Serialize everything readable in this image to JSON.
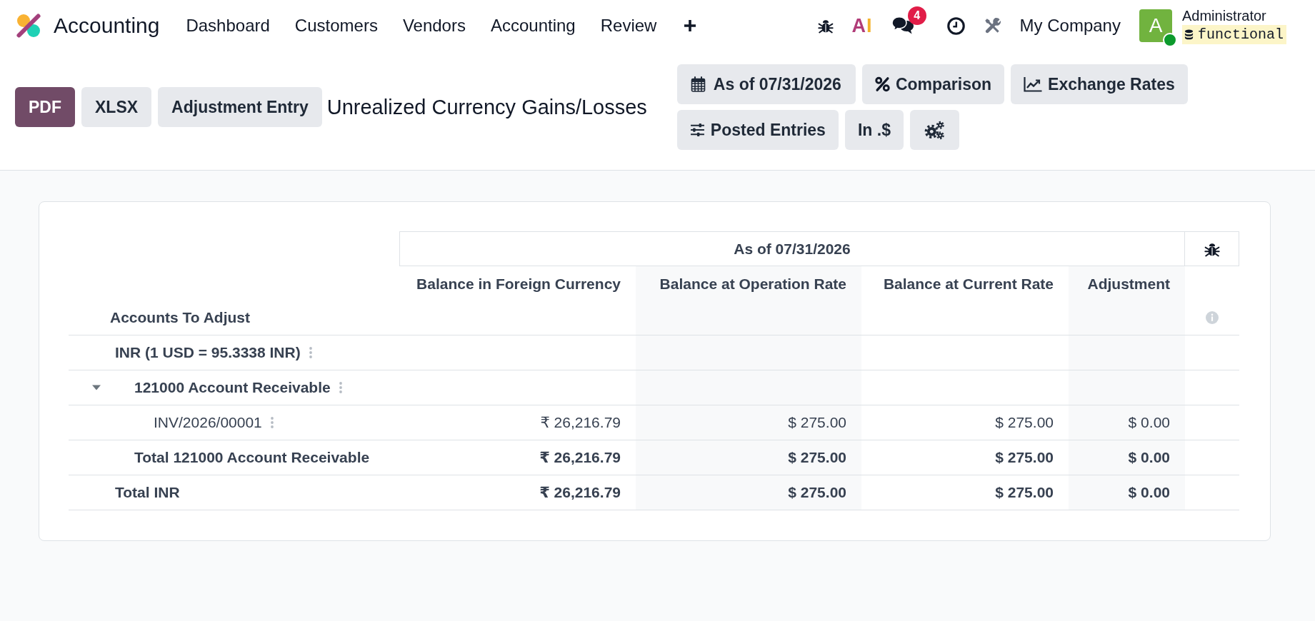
{
  "navbar": {
    "app_name": "Accounting",
    "menu": [
      "Dashboard",
      "Customers",
      "Vendors",
      "Accounting",
      "Review"
    ]
  },
  "systray": {
    "ai_label": "AI",
    "chat_count": "4",
    "company": "My Company",
    "user": {
      "avatar_letter": "A",
      "online": true,
      "name": "Administrator",
      "database": "functional"
    }
  },
  "control_panel": {
    "buttons": [
      {
        "label": "PDF",
        "primary": true
      },
      {
        "label": "XLSX",
        "primary": false
      },
      {
        "label": "Adjustment Entry",
        "primary": false
      }
    ],
    "title": "Unrealized Currency Gains/Losses",
    "filters": [
      {
        "kind": "date",
        "label": "As of 07/31/2026"
      },
      {
        "kind": "comparison",
        "label": "Comparison"
      },
      {
        "kind": "rates",
        "label": "Exchange Rates"
      },
      {
        "kind": "entries",
        "label": "Posted Entries"
      },
      {
        "kind": "currency",
        "label": "In .$"
      },
      {
        "kind": "options"
      }
    ]
  },
  "report": {
    "period": "As of 07/31/2026",
    "row_header": "Accounts To Adjust",
    "columns": [
      "Balance in Foreign Currency",
      "Balance at Operation Rate",
      "Balance at Current Rate",
      "Adjustment"
    ],
    "rows": [
      {
        "kind": "group",
        "label": "INR (1 USD = 95.3338 INR)",
        "children": [
          {
            "kind": "account",
            "label": "121000 Account Receivable",
            "expanded": true,
            "children": [
              {
                "kind": "line",
                "label": "INV/2026/00001",
                "values": [
                  "₹ 26,216.79",
                  "$ 275.00",
                  "$ 275.00",
                  "$ 0.00"
                ]
              }
            ]
          },
          {
            "kind": "total",
            "label": "Total 121000 Account Receivable",
            "values": [
              "₹ 26,216.79",
              "$ 275.00",
              "$ 275.00",
              "$ 0.00"
            ]
          }
        ]
      },
      {
        "kind": "total",
        "label": "Total INR",
        "values": [
          "₹ 26,216.79",
          "$ 275.00",
          "$ 275.00",
          "$ 0.00"
        ]
      }
    ]
  }
}
